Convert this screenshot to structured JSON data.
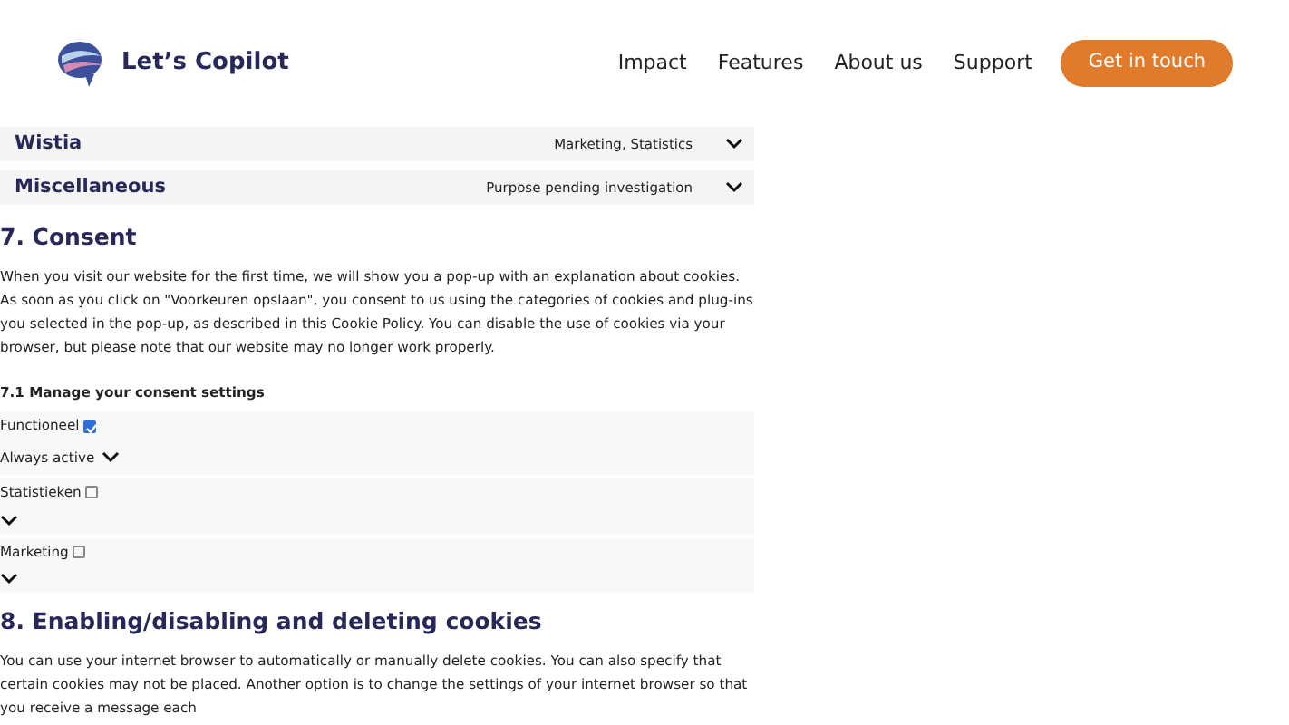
{
  "header": {
    "brand": "Let’s Copilot",
    "nav": [
      {
        "label": "Impact"
      },
      {
        "label": "Features"
      },
      {
        "label": "About us"
      },
      {
        "label": "Support"
      }
    ],
    "cta": "Get in touch"
  },
  "services": [
    {
      "name": "Wistia",
      "purpose": "Marketing, Statistics",
      "expanded": false
    },
    {
      "name": "Miscellaneous",
      "purpose": "Purpose pending investigation",
      "expanded": false
    }
  ],
  "section7": {
    "heading": "7. Consent",
    "text": "When you visit our website for the first time, we will show you a pop-up with an explanation about cookies. As soon as you click on \"Voorkeuren opslaan\", you consent to us using the categories of cookies and plug-ins you selected in the pop-up, as described in this Cookie Policy. You can disable the use of cookies via your browser, but please note that our website may no longer work properly.",
    "subheading": "7.1 Manage your consent settings",
    "consents": [
      {
        "label": "Functioneel",
        "checked": true,
        "status": "Always active"
      },
      {
        "label": "Statistieken",
        "checked": false
      },
      {
        "label": "Marketing",
        "checked": false
      }
    ]
  },
  "section8": {
    "heading": "8. Enabling/disabling and deleting cookies",
    "text": "You can use your internet browser to automatically or manually delete cookies. You can also specify that certain cookies may not be placed. Another option is to change the settings of your internet browser so that you receive a message each"
  }
}
